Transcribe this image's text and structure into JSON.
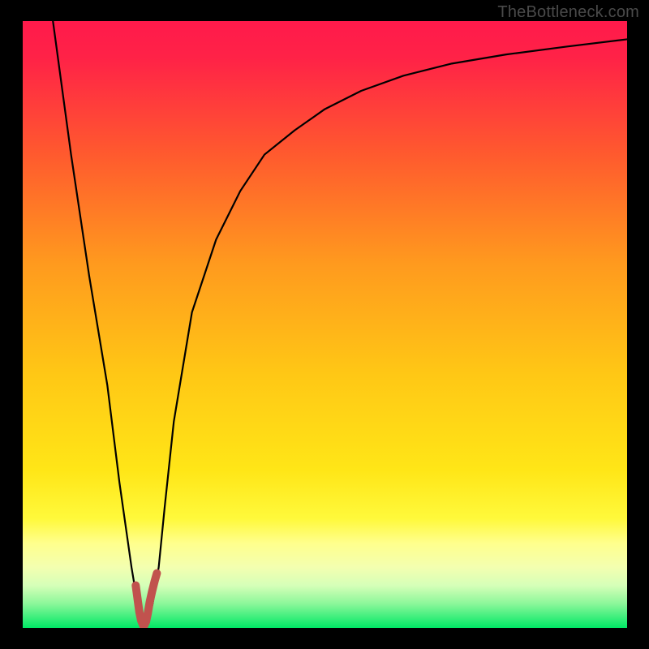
{
  "watermark": "TheBottleneck.com",
  "chart_data": {
    "type": "line",
    "title": "",
    "xlabel": "",
    "ylabel": "",
    "xlim": [
      0,
      100
    ],
    "ylim": [
      0,
      100
    ],
    "grid": false,
    "background_gradient": {
      "top": "#ff1a4b",
      "mid_upper": "#ff8a1f",
      "mid": "#ffe315",
      "lower_band": "#ffff8a",
      "bottom": "#00e865"
    },
    "series": [
      {
        "name": "bottleneck-curve",
        "color": "#000000",
        "x": [
          5,
          8,
          11,
          14,
          16,
          18,
          19,
          20,
          20.5,
          21,
          21.5,
          22.5,
          23.5,
          25,
          28,
          32,
          36,
          40,
          45,
          50,
          56,
          63,
          71,
          80,
          90,
          100
        ],
        "y": [
          100,
          78,
          58,
          40,
          24,
          10,
          4,
          2,
          0,
          2,
          4,
          10,
          20,
          34,
          52,
          64,
          72,
          78,
          82,
          85.5,
          88.5,
          91,
          93,
          94.5,
          95.8,
          97
        ]
      },
      {
        "name": "highlight-trough",
        "color": "#c1524e",
        "x": [
          18.7,
          19.0,
          19.3,
          19.6,
          20.0,
          20.4,
          20.7,
          21.0,
          21.4,
          21.8,
          22.2
        ],
        "y": [
          7.0,
          4.8,
          2.6,
          1.2,
          0.2,
          1.0,
          2.4,
          4.2,
          6.0,
          7.6,
          9.0
        ]
      }
    ],
    "annotations": []
  }
}
